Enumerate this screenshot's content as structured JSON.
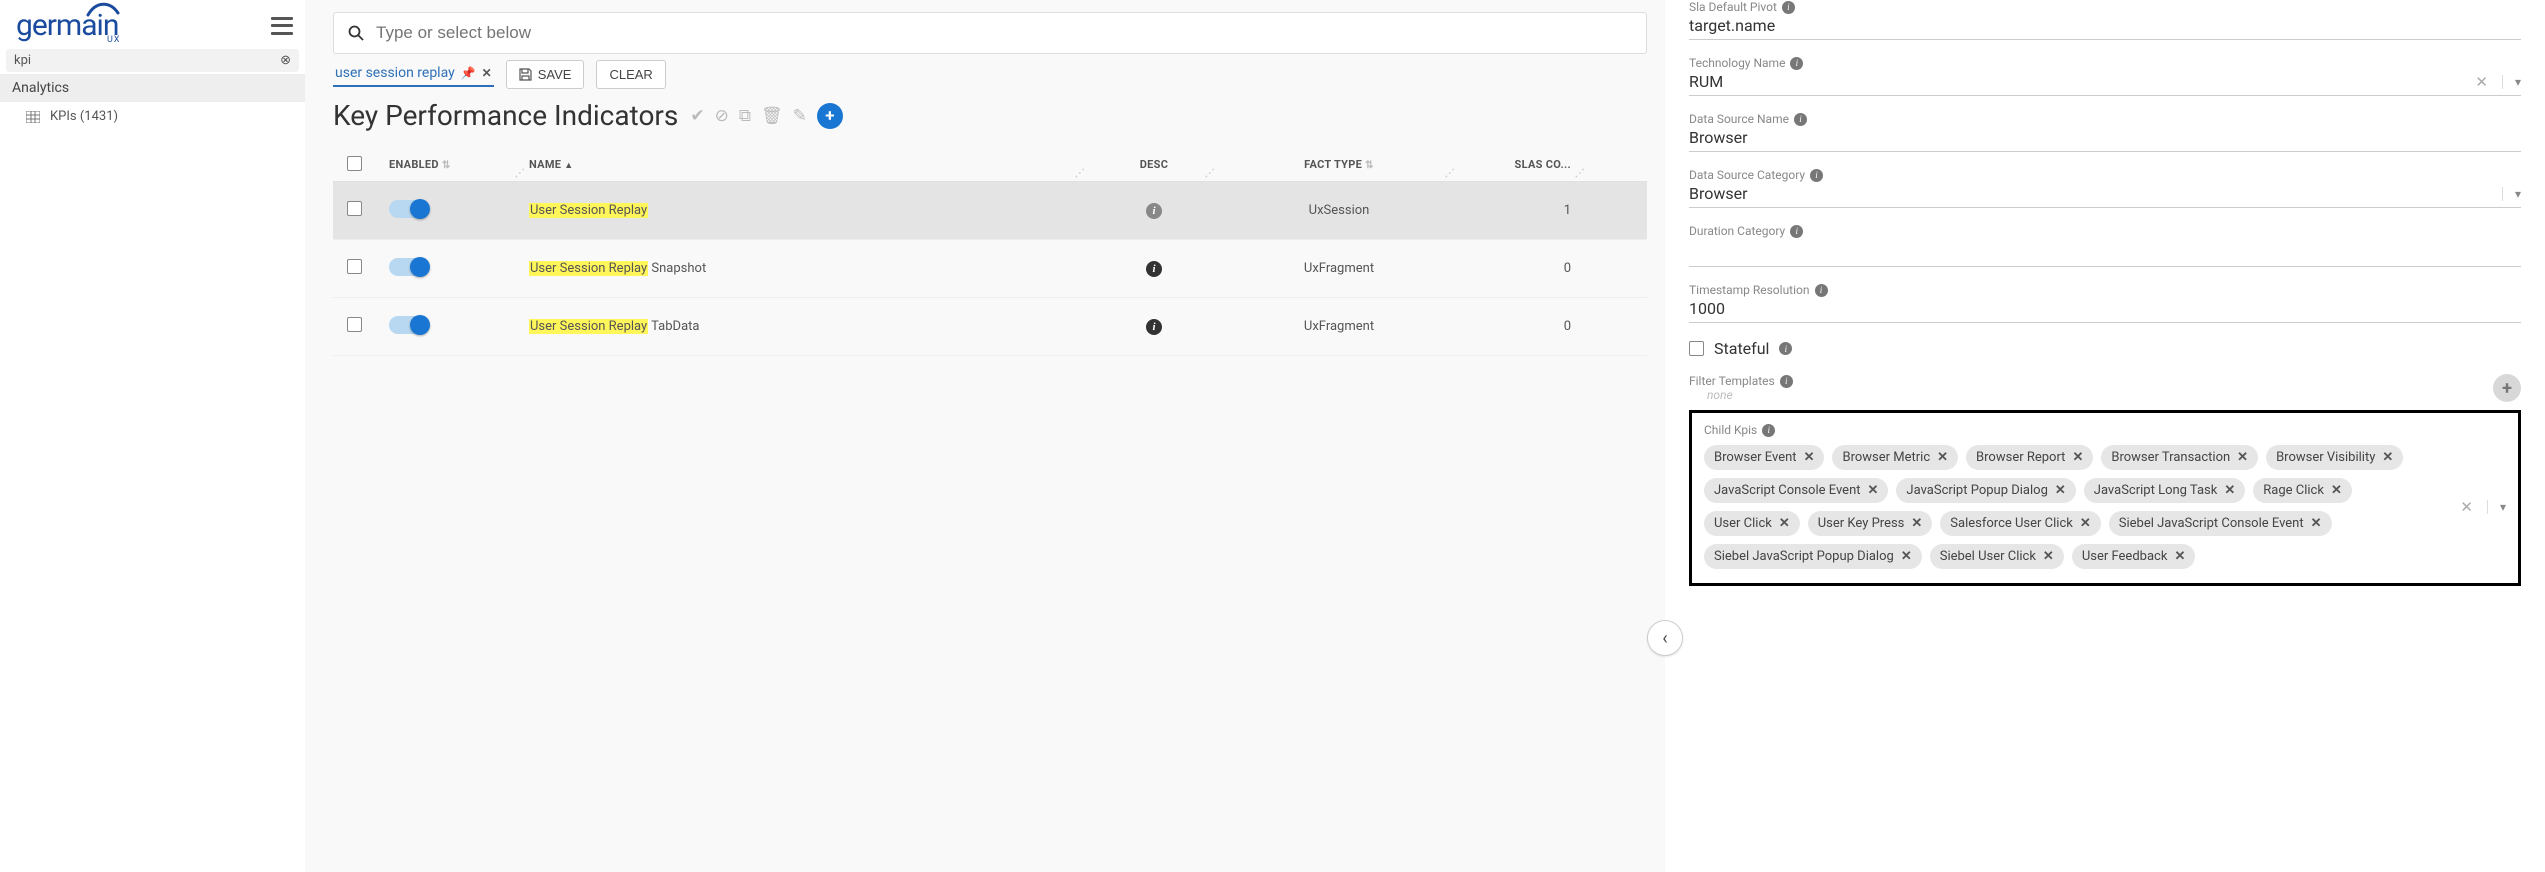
{
  "logo": {
    "brand": "germain",
    "sub": "UX"
  },
  "leftFilter": "kpi",
  "leftSection": "Analytics",
  "leftItem": {
    "label": "KPIs",
    "count": "(1431)"
  },
  "search": {
    "placeholder": "Type or select below"
  },
  "filterTag": "user session replay",
  "buttons": {
    "save": "SAVE",
    "clear": "CLEAR"
  },
  "pageTitle": "Key Performance Indicators",
  "columns": {
    "enabled": "ENABLED",
    "name": "NAME",
    "desc": "DESC",
    "factType": "FACT TYPE",
    "slas": "SLAS CO..."
  },
  "rows": [
    {
      "enabled": true,
      "nameHL": "User Session Replay",
      "nameRest": "",
      "factType": "UxSession",
      "slas": "1",
      "selected": true,
      "infoGrey": true
    },
    {
      "enabled": true,
      "nameHL": "User Session Replay",
      "nameRest": " Snapshot",
      "factType": "UxFragment",
      "slas": "0",
      "selected": false,
      "infoGrey": false
    },
    {
      "enabled": true,
      "nameHL": "User Session Replay",
      "nameRest": " TabData",
      "factType": "UxFragment",
      "slas": "0",
      "selected": false,
      "infoGrey": false
    }
  ],
  "detail": {
    "slaDefaultPivot": {
      "label": "Sla Default Pivot",
      "value": "target.name"
    },
    "technologyName": {
      "label": "Technology Name",
      "value": "RUM",
      "clearable": true,
      "dropdown": true
    },
    "dataSourceName": {
      "label": "Data Source Name",
      "value": "Browser"
    },
    "dataSourceCategory": {
      "label": "Data Source Category",
      "value": "Browser",
      "dropdown": true
    },
    "durationCategory": {
      "label": "Duration Category",
      "value": ""
    },
    "timestampResolution": {
      "label": "Timestamp Resolution",
      "value": "1000"
    },
    "stateful": {
      "label": "Stateful",
      "checked": false
    },
    "filterTemplates": {
      "label": "Filter Templates",
      "value": "none"
    },
    "childKpis": {
      "label": "Child Kpis",
      "items": [
        "Browser Event",
        "Browser Metric",
        "Browser Report",
        "Browser Transaction",
        "Browser Visibility",
        "JavaScript Console Event",
        "JavaScript Popup Dialog",
        "JavaScript Long Task",
        "Rage Click",
        "User Click",
        "User Key Press",
        "Salesforce User Click",
        "Siebel JavaScript Console Event",
        "Siebel JavaScript Popup Dialog",
        "Siebel User Click",
        "User Feedback"
      ]
    }
  }
}
